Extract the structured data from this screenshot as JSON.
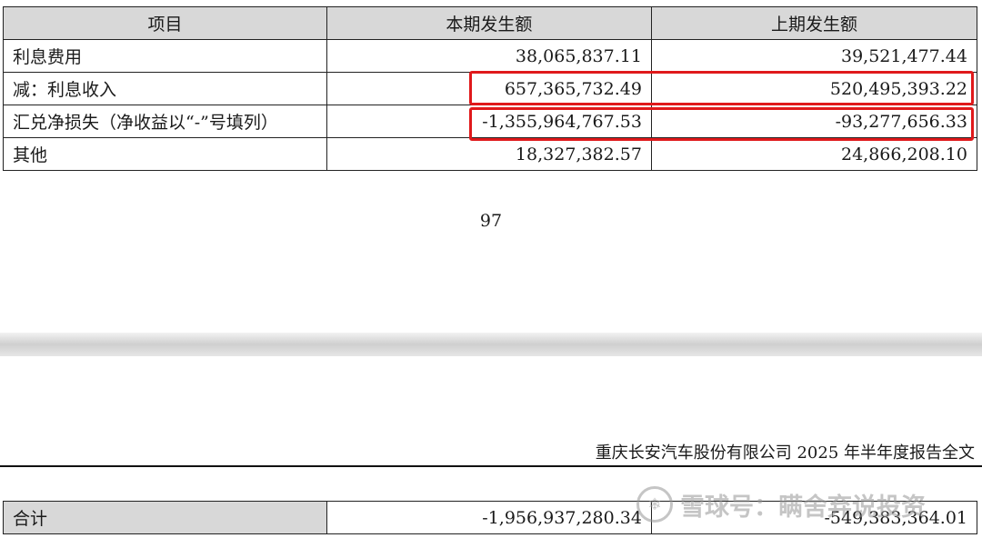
{
  "table": {
    "headers": [
      "项目",
      "本期发生额",
      "上期发生额"
    ],
    "rows": [
      {
        "item": "利息费用",
        "current": "38,065,837.11",
        "previous": "39,521,477.44"
      },
      {
        "item": "减：利息收入",
        "current": "657,365,732.49",
        "previous": "520,495,393.22"
      },
      {
        "item": "汇兑净损失（净收益以“-”号填列）",
        "current": "-1,355,964,767.53",
        "previous": "-93,277,656.33"
      },
      {
        "item": "其他",
        "current": "18,327,382.57",
        "previous": "24,866,208.10"
      }
    ]
  },
  "page_number": "97",
  "running_header": "重庆长安汽车股份有限公司 2025 年半年度报告全文",
  "total": {
    "label": "合计",
    "current": "-1,956,937,280.34",
    "previous": "-549,383,364.01"
  },
  "watermark": {
    "text": "雪球号：瞒舍弃说投资",
    "logo": "snowball-logo-icon"
  },
  "colors": {
    "highlight": "#e0191b",
    "header_bg": "#d8d8d8"
  }
}
